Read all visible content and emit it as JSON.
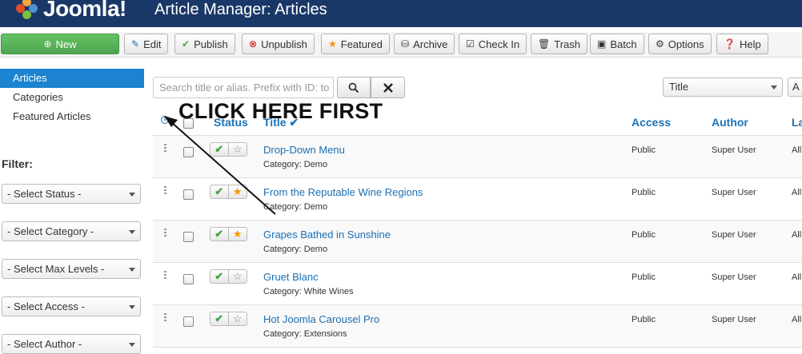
{
  "app": {
    "logo_text": "Joomla!",
    "page_title": "Article Manager: Articles"
  },
  "toolbar": {
    "new": "New",
    "edit": "Edit",
    "publish": "Publish",
    "unpublish": "Unpublish",
    "featured": "Featured",
    "archive": "Archive",
    "checkin": "Check In",
    "trash": "Trash",
    "batch": "Batch",
    "options": "Options",
    "help": "Help"
  },
  "sidebar": {
    "items": [
      {
        "label": "Articles",
        "active": true
      },
      {
        "label": "Categories"
      },
      {
        "label": "Featured Articles"
      }
    ],
    "filter_label": "Filter:",
    "filters": [
      "- Select Status -",
      "- Select Category -",
      "- Select Max Levels -",
      "- Select Access -",
      "- Select Author -"
    ]
  },
  "search": {
    "placeholder": "Search title or alias. Prefix with ID: to"
  },
  "sort": {
    "selected": "Title",
    "direction_partial": "A"
  },
  "table": {
    "headers": {
      "status": "Status",
      "title": "Title",
      "access": "Access",
      "author": "Author",
      "language_partial": "La"
    },
    "rows": [
      {
        "title": "Drop-Down Menu",
        "category": "Category: Demo",
        "access": "Public",
        "author": "Super User",
        "lang": "All",
        "featured": false
      },
      {
        "title": "From the Reputable Wine Regions",
        "category": "Category: Demo",
        "access": "Public",
        "author": "Super User",
        "lang": "All",
        "featured": true
      },
      {
        "title": "Grapes Bathed in Sunshine",
        "category": "Category: Demo",
        "access": "Public",
        "author": "Super User",
        "lang": "All",
        "featured": true
      },
      {
        "title": "Gruet Blanc",
        "category": "Category: White Wines",
        "access": "Public",
        "author": "Super User",
        "lang": "All",
        "featured": false
      },
      {
        "title": "Hot Joomla Carousel Pro",
        "category": "Category: Extensions",
        "access": "Public",
        "author": "Super User",
        "lang": "All",
        "featured": false
      }
    ]
  },
  "annotation": {
    "text": "CLICK HERE FIRST"
  },
  "colors": {
    "header_bg": "#1a3867",
    "accent": "#1b83cf",
    "link": "#1b6fb3",
    "new_button": "#51a351",
    "star": "#f89406"
  }
}
